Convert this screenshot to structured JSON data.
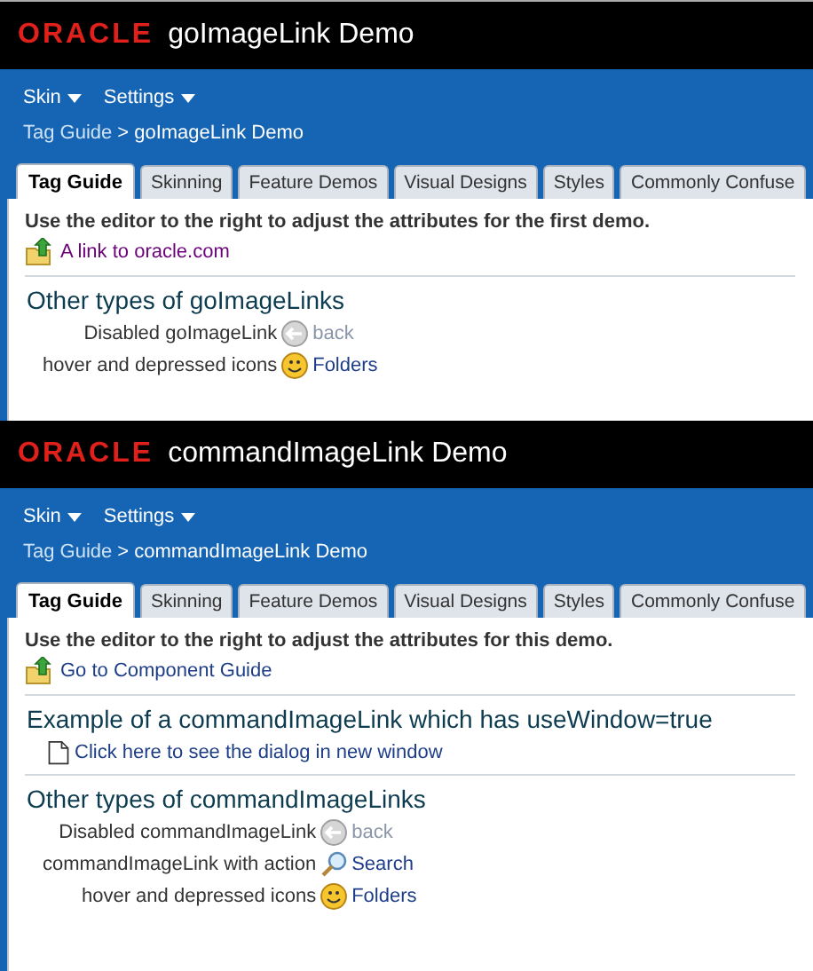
{
  "panels": [
    {
      "logo": "ORACLE",
      "title": "goImageLink Demo",
      "menus": [
        "Skin",
        "Settings"
      ],
      "breadcrumb": {
        "items": [
          "Tag Guide",
          "goImageLink Demo"
        ],
        "separator": ">"
      },
      "tabs": [
        {
          "label": "Tag Guide",
          "selected": true
        },
        {
          "label": "Skinning",
          "selected": false
        },
        {
          "label": "Feature Demos",
          "selected": false
        },
        {
          "label": "Visual Designs",
          "selected": false
        },
        {
          "label": "Styles",
          "selected": false
        },
        {
          "label": "Commonly Confuse",
          "selected": false
        }
      ],
      "intro": "Use the editor to the right to adjust the attributes for the first demo.",
      "top_link": {
        "text": "A link to oracle.com",
        "visited": true
      },
      "sections": [
        {
          "heading": "Other types of goImageLinks",
          "rows": [
            {
              "label": "Disabled goImageLink",
              "kind": "back",
              "link": "back",
              "disabled": true
            },
            {
              "label": "hover and depressed icons",
              "kind": "smiley",
              "link": "Folders",
              "disabled": false
            }
          ]
        }
      ]
    },
    {
      "logo": "ORACLE",
      "title": "commandImageLink Demo",
      "menus": [
        "Skin",
        "Settings"
      ],
      "breadcrumb": {
        "items": [
          "Tag Guide",
          "commandImageLink Demo"
        ],
        "separator": ">"
      },
      "tabs": [
        {
          "label": "Tag Guide",
          "selected": true
        },
        {
          "label": "Skinning",
          "selected": false
        },
        {
          "label": "Feature Demos",
          "selected": false
        },
        {
          "label": "Visual Designs",
          "selected": false
        },
        {
          "label": "Styles",
          "selected": false
        },
        {
          "label": "Commonly Confuse",
          "selected": false
        }
      ],
      "intro": "Use the editor to the right to adjust the attributes for this demo.",
      "top_link": {
        "text": "Go to Component Guide",
        "visited": false
      },
      "sections": [
        {
          "heading": "Example of a commandImageLink which has useWindow=true",
          "rows": [
            {
              "kind": "page",
              "link": "Click here to see the dialog in new window",
              "disabled": false
            }
          ]
        },
        {
          "heading": "Other types of commandImageLinks",
          "rows": [
            {
              "label": "Disabled commandImageLink",
              "kind": "back",
              "link": "back",
              "disabled": true
            },
            {
              "label": "commandImageLink with action",
              "kind": "search",
              "link": "Search",
              "disabled": false
            },
            {
              "label": "hover and depressed icons",
              "kind": "smiley",
              "link": "Folders",
              "disabled": false
            }
          ]
        }
      ]
    }
  ]
}
